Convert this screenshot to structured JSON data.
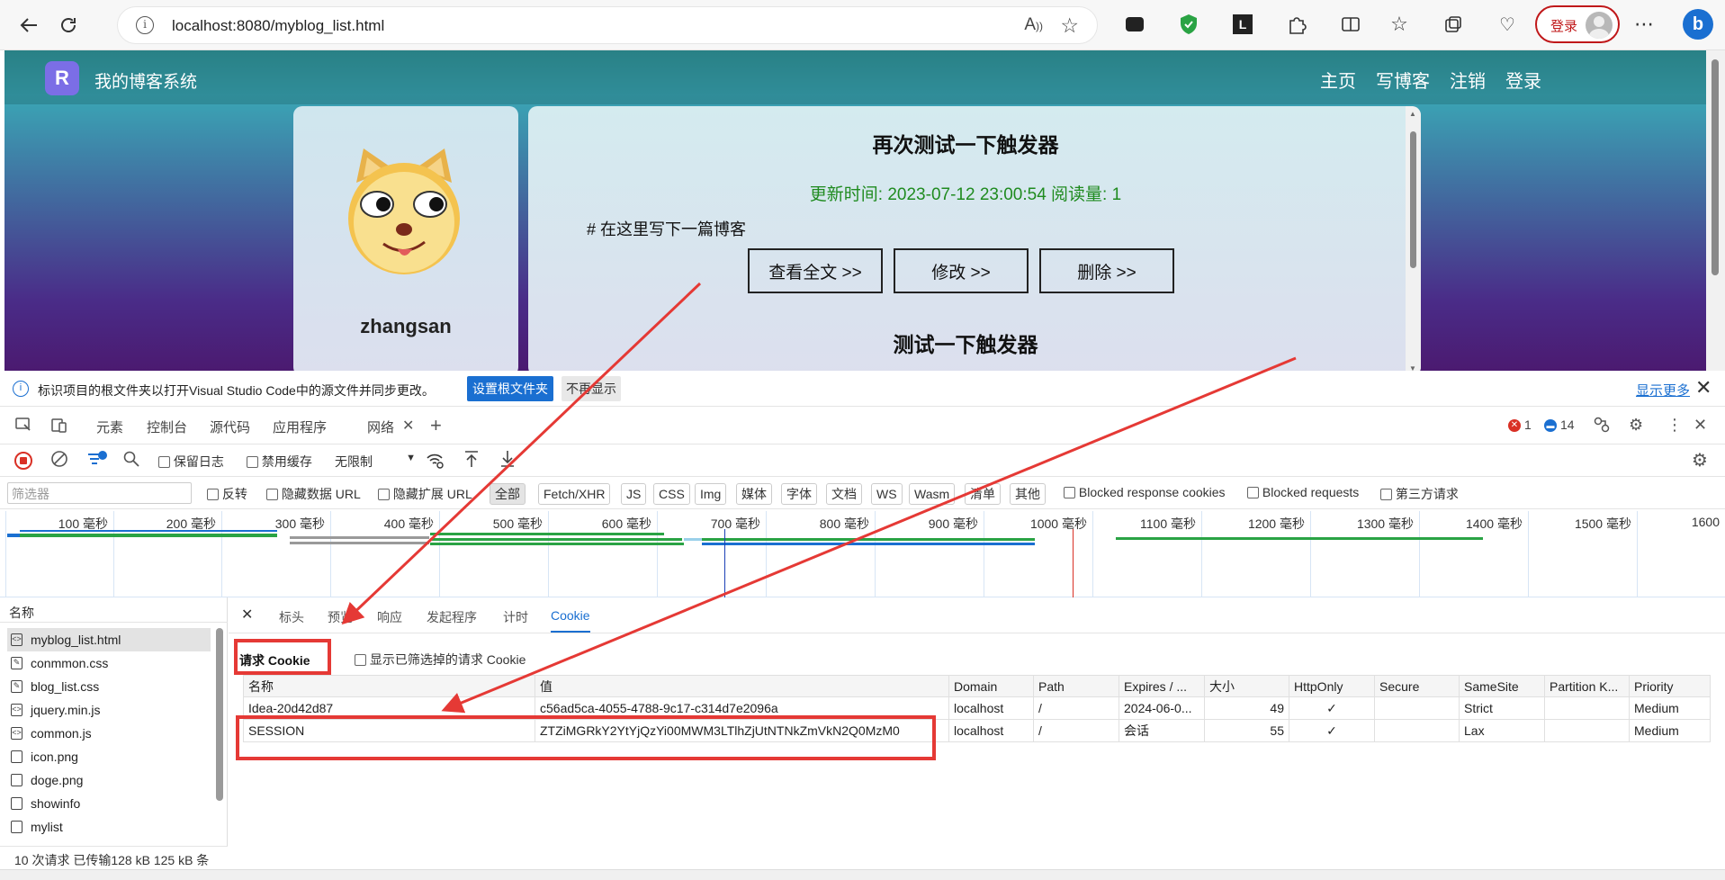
{
  "browser": {
    "url": "localhost:8080/myblog_list.html",
    "login_label": "登录"
  },
  "site": {
    "logo_letter": "R",
    "title": "我的博客系统",
    "nav": [
      "主页",
      "写博客",
      "注销",
      "登录"
    ]
  },
  "profile": {
    "username": "zhangsan"
  },
  "post1": {
    "title": "再次测试一下触发器",
    "meta": "更新时间: 2023-07-12 23:00:54   阅读量: 1",
    "body": "# 在这里写下一篇博客",
    "buttons": [
      "查看全文 >>",
      "修改 >>",
      "删除 >>"
    ]
  },
  "post2": {
    "title": "测试一下触发器"
  },
  "devtools": {
    "infobar": {
      "message": "标识项目的根文件夹以打开Visual Studio Code中的源文件并同步更改。",
      "primary_button": "设置根文件夹",
      "secondary_button": "不再显示",
      "more_link": "显示更多"
    },
    "tabs": [
      "元素",
      "控制台",
      "源代码",
      "应用程序",
      "网络"
    ],
    "error_count": "1",
    "message_count": "14",
    "toolbar": {
      "preserve_log": "保留日志",
      "disable_cache": "禁用缓存",
      "throttle": "无限制"
    },
    "filter": {
      "placeholder": "筛选器",
      "invert": "反转",
      "hide_data_url": "隐藏数据 URL",
      "hide_ext_url": "隐藏扩展 URL",
      "types": [
        "全部",
        "Fetch/XHR",
        "JS",
        "CSS",
        "Img",
        "媒体",
        "字体",
        "文档",
        "WS",
        "Wasm",
        "清单",
        "其他"
      ],
      "blocked_cookies": "Blocked response cookies",
      "blocked_requests": "Blocked requests",
      "third_party": "第三方请求"
    },
    "timeline_ticks": [
      "100 毫秒",
      "200 毫秒",
      "300 毫秒",
      "400 毫秒",
      "500 毫秒",
      "600 毫秒",
      "700 毫秒",
      "800 毫秒",
      "900 毫秒",
      "1000 毫秒",
      "1100 毫秒",
      "1200 毫秒",
      "1300 毫秒",
      "1400 毫秒",
      "1500 毫秒",
      "1600"
    ],
    "requests": {
      "header": "名称",
      "items": [
        "myblog_list.html",
        "conmmon.css",
        "blog_list.css",
        "jquery.min.js",
        "common.js",
        "icon.png",
        "doge.png",
        "showinfo",
        "mylist"
      ],
      "status": "10 次请求   已传输128 kB   125 kB 条"
    },
    "detail_tabs": [
      "标头",
      "预览",
      "响应",
      "发起程序",
      "计时",
      "Cookie"
    ],
    "cookies": {
      "section_title": "请求 Cookie",
      "show_filtered": "显示已筛选掉的请求 Cookie",
      "columns": [
        "名称",
        "值",
        "Domain",
        "Path",
        "Expires / ...",
        "大小",
        "HttpOnly",
        "Secure",
        "SameSite",
        "Partition K...",
        "Priority"
      ],
      "rows": [
        [
          "Idea-20d42d87",
          "c56ad5ca-4055-4788-9c17-c314d7e2096a",
          "localhost",
          "/",
          "2024-06-0...",
          "49",
          "✓",
          "",
          "Strict",
          "",
          "Medium"
        ],
        [
          "SESSION",
          "ZTZiMGRkY2YtYjQzYi00MWM3LTlhZjUtNTNkZmVkN2Q0MzM0",
          "localhost",
          "/",
          "会话",
          "55",
          "✓",
          "",
          "Lax",
          "",
          "Medium"
        ]
      ]
    }
  }
}
